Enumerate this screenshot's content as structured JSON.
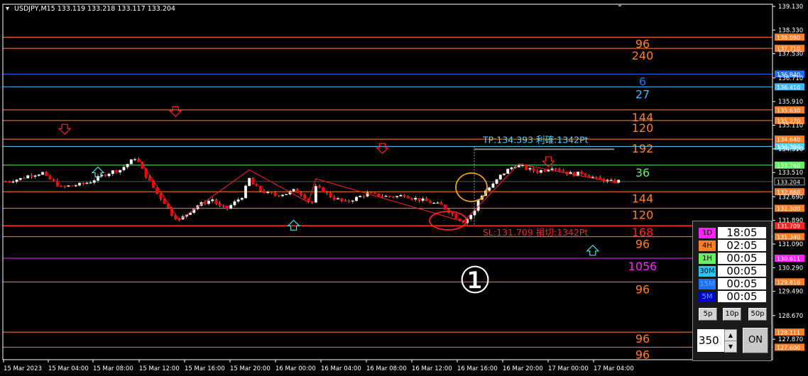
{
  "header": {
    "dropdown_icon": "triangle-down-icon",
    "title": "USDJPY,M15  133.119 133.218 133.117 133.204"
  },
  "chart_data": {
    "type": "candlestick",
    "symbol": "USDJPY",
    "timeframe": "M15",
    "ohlc": {
      "open": 133.119,
      "high": 133.218,
      "low": 133.117,
      "close": 133.204
    },
    "y_axis": {
      "ticks": [
        "139.130",
        "138.330",
        "137.530",
        "136.710",
        "135.910",
        "135.110",
        "134.310",
        "133.510",
        "132.690",
        "131.890",
        "131.090",
        "130.290",
        "129.490",
        "128.670",
        "127.870"
      ],
      "ylim": [
        127.0,
        139.3
      ]
    },
    "x_axis": {
      "ticks": [
        "15 Mar 2023",
        "15 Mar 04:00",
        "15 Mar 08:00",
        "15 Mar 12:00",
        "15 Mar 16:00",
        "15 Mar 20:00",
        "16 Mar 00:00",
        "16 Mar 04:00",
        "16 Mar 08:00",
        "16 Mar 12:00",
        "16 Mar 16:00",
        "16 Mar 20:00",
        "17 Mar 00:00",
        "17 Mar 04:00"
      ]
    },
    "price_path": [
      [
        0,
        133.2
      ],
      [
        2,
        133.25
      ],
      [
        4,
        133.3
      ],
      [
        6,
        133.4
      ],
      [
        8,
        133.45
      ],
      [
        10,
        133.5
      ],
      [
        11,
        133.35
      ],
      [
        13,
        133.2
      ],
      [
        15,
        133.0
      ],
      [
        17,
        133.05
      ],
      [
        20,
        133.1
      ],
      [
        23,
        133.2
      ],
      [
        26,
        133.4
      ],
      [
        29,
        133.55
      ],
      [
        31,
        133.6
      ],
      [
        33,
        133.8
      ],
      [
        35,
        134.0
      ],
      [
        36,
        133.85
      ],
      [
        37,
        133.6
      ],
      [
        39,
        133.2
      ],
      [
        41,
        132.8
      ],
      [
        43,
        132.5
      ],
      [
        45,
        132.1
      ],
      [
        47,
        131.9
      ],
      [
        48,
        132.0
      ],
      [
        50,
        132.2
      ],
      [
        52,
        132.4
      ],
      [
        54,
        132.5
      ],
      [
        56,
        132.6
      ],
      [
        58,
        132.35
      ],
      [
        60,
        132.3
      ],
      [
        62,
        132.5
      ],
      [
        64,
        132.7
      ],
      [
        66,
        133.3
      ],
      [
        67,
        133.1
      ],
      [
        69,
        132.9
      ],
      [
        71,
        132.8
      ],
      [
        73,
        132.75
      ],
      [
        76,
        132.8
      ],
      [
        78,
        132.9
      ],
      [
        80,
        132.8
      ],
      [
        82,
        132.55
      ],
      [
        83,
        132.5
      ],
      [
        84,
        133.0
      ],
      [
        86,
        132.9
      ],
      [
        88,
        132.7
      ],
      [
        90,
        132.6
      ],
      [
        92,
        132.5
      ],
      [
        94,
        132.6
      ],
      [
        96,
        132.7
      ],
      [
        98,
        132.8
      ],
      [
        100,
        132.75
      ],
      [
        103,
        132.7
      ],
      [
        106,
        132.7
      ],
      [
        108,
        132.75
      ],
      [
        110,
        132.65
      ],
      [
        112,
        132.6
      ],
      [
        115,
        132.5
      ],
      [
        118,
        132.4
      ],
      [
        120,
        132.2
      ],
      [
        122,
        132.0
      ],
      [
        124,
        131.85
      ],
      [
        125,
        131.95
      ],
      [
        127,
        132.2
      ],
      [
        128,
        132.6
      ],
      [
        130,
        132.9
      ],
      [
        132,
        133.1
      ],
      [
        134,
        133.4
      ],
      [
        136,
        133.6
      ],
      [
        138,
        133.75
      ],
      [
        140,
        133.7
      ],
      [
        142,
        133.6
      ],
      [
        144,
        133.55
      ],
      [
        146,
        133.6
      ],
      [
        148,
        133.7
      ],
      [
        150,
        133.6
      ],
      [
        152,
        133.5
      ],
      [
        154,
        133.45
      ],
      [
        156,
        133.5
      ],
      [
        158,
        133.4
      ],
      [
        160,
        133.3
      ],
      [
        162,
        133.25
      ],
      [
        164,
        133.2
      ],
      [
        166,
        133.22
      ]
    ],
    "candle_count": 167,
    "horizontal_levels": [
      {
        "price": 138.09,
        "label": "138.090",
        "color": "#ff7f27",
        "annotation": "96"
      },
      {
        "price": 137.71,
        "label": "137.710",
        "color": "#ff7f27",
        "annotation": "240"
      },
      {
        "price": 136.84,
        "label": "136.840",
        "color": "#1f6fff",
        "annotation": "6"
      },
      {
        "price": 136.41,
        "label": "136.410",
        "color": "#3fb8ff",
        "annotation": "27"
      },
      {
        "price": 135.63,
        "label": "135.630",
        "color": "#ff7f27",
        "annotation": "144"
      },
      {
        "price": 135.27,
        "label": "135.270",
        "color": "#ff7f27",
        "annotation": "120"
      },
      {
        "price": 134.64,
        "label": "134.640",
        "color": "#ff7f27",
        "annotation": "192"
      },
      {
        "price": 134.393,
        "label": "134.393",
        "color": "#55d5ff",
        "annotation": ""
      },
      {
        "price": 133.76,
        "label": "133.760",
        "color": "#66ee66",
        "annotation": "36"
      },
      {
        "price": 132.86,
        "label": "132.860",
        "color": "#ff7f27",
        "annotation": "144"
      },
      {
        "price": 132.3,
        "label": "132.300",
        "color": "#ff7f27",
        "annotation": "120"
      },
      {
        "price": 131.709,
        "label": "131.709",
        "color": "#ff2020",
        "annotation": "168"
      },
      {
        "price": 131.34,
        "label": "131.340",
        "color": "#ff7f27",
        "annotation": "96"
      },
      {
        "price": 130.611,
        "label": "130.611",
        "color": "#ff22ff",
        "annotation": "1056"
      },
      {
        "price": 129.81,
        "label": "129.810",
        "color": "#ff7f27",
        "annotation": "96"
      },
      {
        "price": 128.111,
        "label": "128.111",
        "color": "#ff7f27",
        "annotation": "96"
      },
      {
        "price": 127.6,
        "label": "127.600",
        "color": "#ff7f27",
        "annotation": "96"
      }
    ],
    "current_price": {
      "price": 133.204,
      "label": "133.204"
    },
    "tp_label": "TP:134.393 利確:1342Pt",
    "sl_label": "SL:131.709 損切:1342Pt",
    "circled_number": "①",
    "arrows_down": [
      [
        16,
        134.9
      ],
      [
        46,
        135.5
      ],
      [
        102,
        134.25
      ],
      [
        147,
        133.8
      ]
    ],
    "arrows_up": [
      [
        25,
        133.6
      ],
      [
        78,
        131.8
      ],
      [
        159,
        130.95
      ]
    ],
    "colors": {
      "up_candle": "#ffffff",
      "down_candle": "#ff0000",
      "wick": "#c8c8c8",
      "axis": "#ffffff",
      "grid_text": "#ffffff",
      "tp": "#55d5ff",
      "sl": "#ff2020",
      "up_arrow": "#44e0e0",
      "down_arrow": "#ff2020",
      "ellipse_orange": "#e8a020",
      "ellipse_red": "#ff2020"
    }
  },
  "panel": {
    "rows": [
      {
        "label": "1D",
        "time": "18:05",
        "color": "#ff22ff"
      },
      {
        "label": "4H",
        "time": "02:05",
        "color": "#ff7f27"
      },
      {
        "label": "1H",
        "time": "00:05",
        "color": "#66ee66"
      },
      {
        "label": "30M",
        "time": "00:05",
        "color": "#22c8ff"
      },
      {
        "label": "15M",
        "time": "00:05",
        "color": "#1f6fff"
      },
      {
        "label": "5M",
        "time": "00:05",
        "color": "#0000cc"
      }
    ],
    "buttons": [
      "5p",
      "10p",
      "50p"
    ],
    "count_value": "350",
    "up_icon": "arrow-up-icon",
    "down_icon": "arrow-down-icon",
    "on_label": "ON"
  }
}
